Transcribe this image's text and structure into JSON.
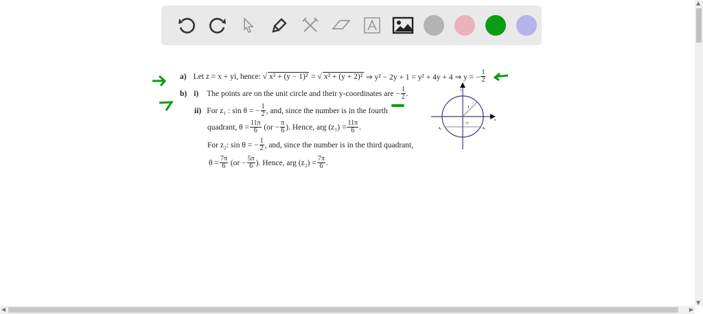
{
  "toolbar": {
    "tools": [
      "undo-icon",
      "redo-icon",
      "pointer-icon",
      "pen-icon",
      "tools-icon",
      "eraser-icon",
      "text-icon",
      "image-icon"
    ],
    "colors": [
      "#b3b3b3",
      "#eab3b8",
      "#0a9c12",
      "#b6b3ea"
    ]
  },
  "solution": {
    "a_label": "a)",
    "a_text1": "Let z = x + yi, hence:",
    "a_sqrt1": "x² + (y − 1)²",
    "a_eq": "=",
    "a_sqrt2": "x² + (y + 2)²",
    "a_text2": "⇒ y² − 2y + 1 = y² + 4y + 4 ⇒ y = −",
    "b_label": "b)",
    "bi_label": "i)",
    "bi_text": "The points are on the unit circle and their y-coordinates are −",
    "bii_label": "ii)",
    "l1a": "For z₁ : sin θ = −",
    "l1b": ", and, since the number is in the fourth",
    "l2a": "quadrant, θ =",
    "l2b": "(or −",
    "l2c": "). Hence, arg (z₁) =",
    "l3a": "For z₂: sin θ = −",
    "l3b": ", and, since the number is in the third quadrant,",
    "l4a": "θ =",
    "l4b": "(or −",
    "l4c": "). Hence, arg (z₂) =",
    "one": "1",
    "two": "2",
    "six": "6",
    "pi": "π",
    "11pi": "11π",
    "7pi": "7π",
    "5pi": "5π",
    "period": "."
  },
  "diagram": {
    "y_label": "y",
    "x_label": "x",
    "radius_label": "1",
    "level_label": "−½",
    "z1": "z₁",
    "z2": "z₂"
  }
}
